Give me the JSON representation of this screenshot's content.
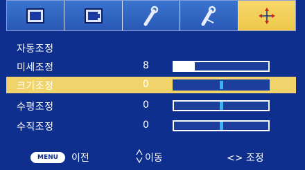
{
  "tabs": [
    {
      "icon": "picture-icon",
      "active": false
    },
    {
      "icon": "screen-icon",
      "active": false
    },
    {
      "icon": "wrench-icon",
      "active": false
    },
    {
      "icon": "tools-icon",
      "active": false
    },
    {
      "icon": "adjust-cross-icon",
      "active": true
    }
  ],
  "menu": {
    "title": "자동조정",
    "rows": [
      {
        "label": "미세조정",
        "value": "8",
        "kind": "fill",
        "level": 0.22
      },
      {
        "label": "크기조정",
        "value": "0",
        "kind": "center",
        "level": 0.5,
        "selected": true
      },
      {
        "label": "수평조정",
        "value": "0",
        "kind": "center",
        "level": 0.5
      },
      {
        "label": "수직조정",
        "value": "0",
        "kind": "center",
        "level": 0.5
      }
    ]
  },
  "footer": {
    "menu_button": "MENU",
    "prev": "이전",
    "move": "이동",
    "adjust": "<> 조정"
  },
  "colors": {
    "background": "#0e2f8e",
    "highlight": "#f0d36a",
    "knob": "#33b7f0"
  }
}
